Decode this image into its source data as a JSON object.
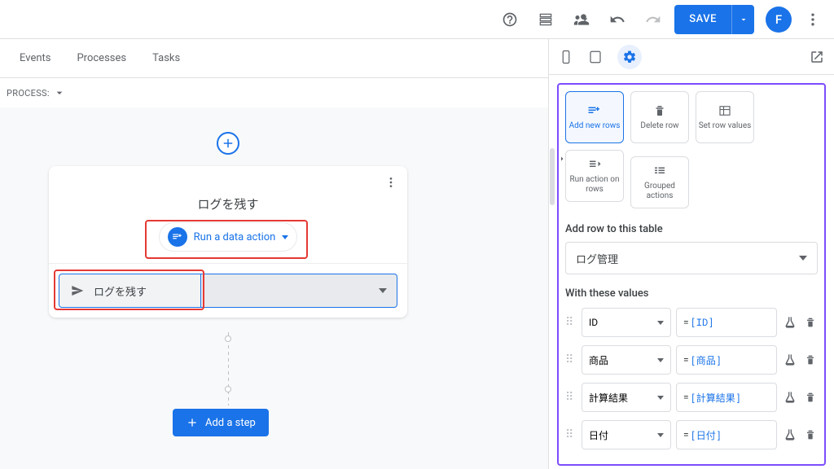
{
  "topbar": {
    "save_label": "SAVE",
    "avatar_letter": "F"
  },
  "tabs": {
    "events": "Events",
    "processes": "Processes",
    "tasks": "Tasks"
  },
  "process_label": "PROCESS:",
  "card": {
    "title": "ログを残す",
    "action_type": "Run a data action",
    "task_name": "ログを残す",
    "add_step": "Add a step"
  },
  "tiles": {
    "add_rows": "Add new rows",
    "delete_row": "Delete row",
    "set_values": "Set row values",
    "run_action": "Run action on rows",
    "grouped": "Grouped actions"
  },
  "right": {
    "add_row_label": "Add row to this table",
    "table_name": "ログ管理",
    "with_values_label": "With these values"
  },
  "rows": [
    {
      "col": "ID",
      "expr": "[ID]"
    },
    {
      "col": "商品",
      "expr": "[商品]"
    },
    {
      "col": "計算結果",
      "expr": "[計算結果]"
    },
    {
      "col": "日付",
      "expr": "[日付]"
    }
  ]
}
